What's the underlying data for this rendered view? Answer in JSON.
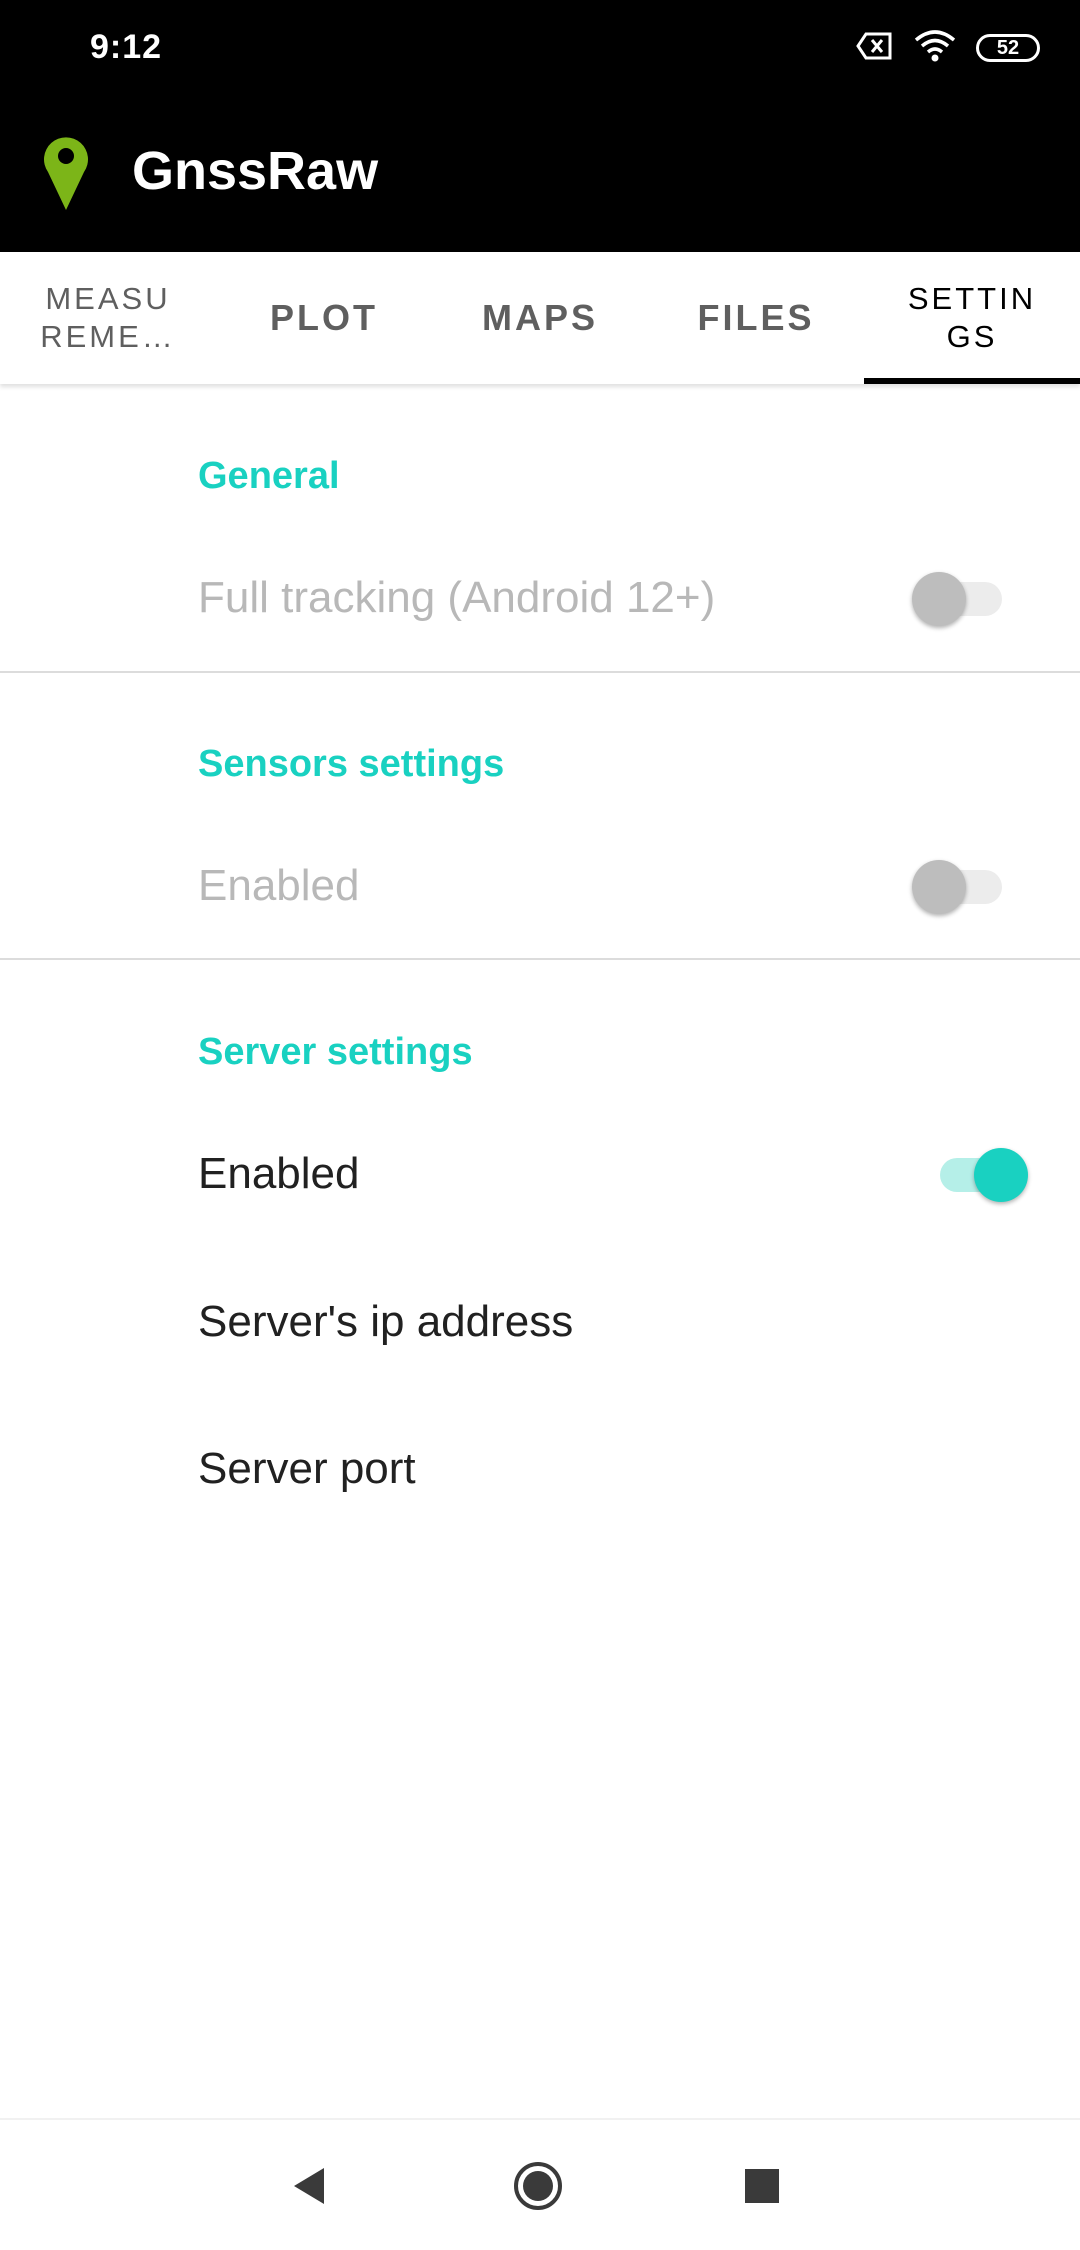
{
  "status_bar": {
    "time": "9:12",
    "battery": "52",
    "icons": [
      "sim-error-icon",
      "wifi-icon",
      "battery-icon"
    ]
  },
  "app_bar": {
    "title": "GnssRaw",
    "logo_icon": "map-pin-icon",
    "logo_color": "#7cb518"
  },
  "tabs": [
    {
      "label": "MEASU\nREME…",
      "active": false
    },
    {
      "label": "PLOT",
      "active": false
    },
    {
      "label": "MAPS",
      "active": false
    },
    {
      "label": "FILES",
      "active": false
    },
    {
      "label": "SETTIN\nGS",
      "active": true
    }
  ],
  "colors": {
    "accent": "#19d1c1",
    "disabled_text": "#b8b8b8",
    "text": "#212121"
  },
  "sections": {
    "general": {
      "header": "General",
      "full_tracking": {
        "title": "Full tracking (Android 12+)",
        "enabled": false,
        "checked": false
      }
    },
    "sensors": {
      "header": "Sensors settings",
      "enabled_pref": {
        "title": "Enabled",
        "enabled": false,
        "checked": false
      }
    },
    "server": {
      "header": "Server settings",
      "enabled_pref": {
        "title": "Enabled",
        "enabled": true,
        "checked": true
      },
      "ip_address": {
        "title": "Server's ip address"
      },
      "port": {
        "title": "Server port"
      }
    }
  },
  "nav_bar": {
    "icons": [
      "back-icon",
      "home-icon",
      "recents-icon"
    ]
  }
}
